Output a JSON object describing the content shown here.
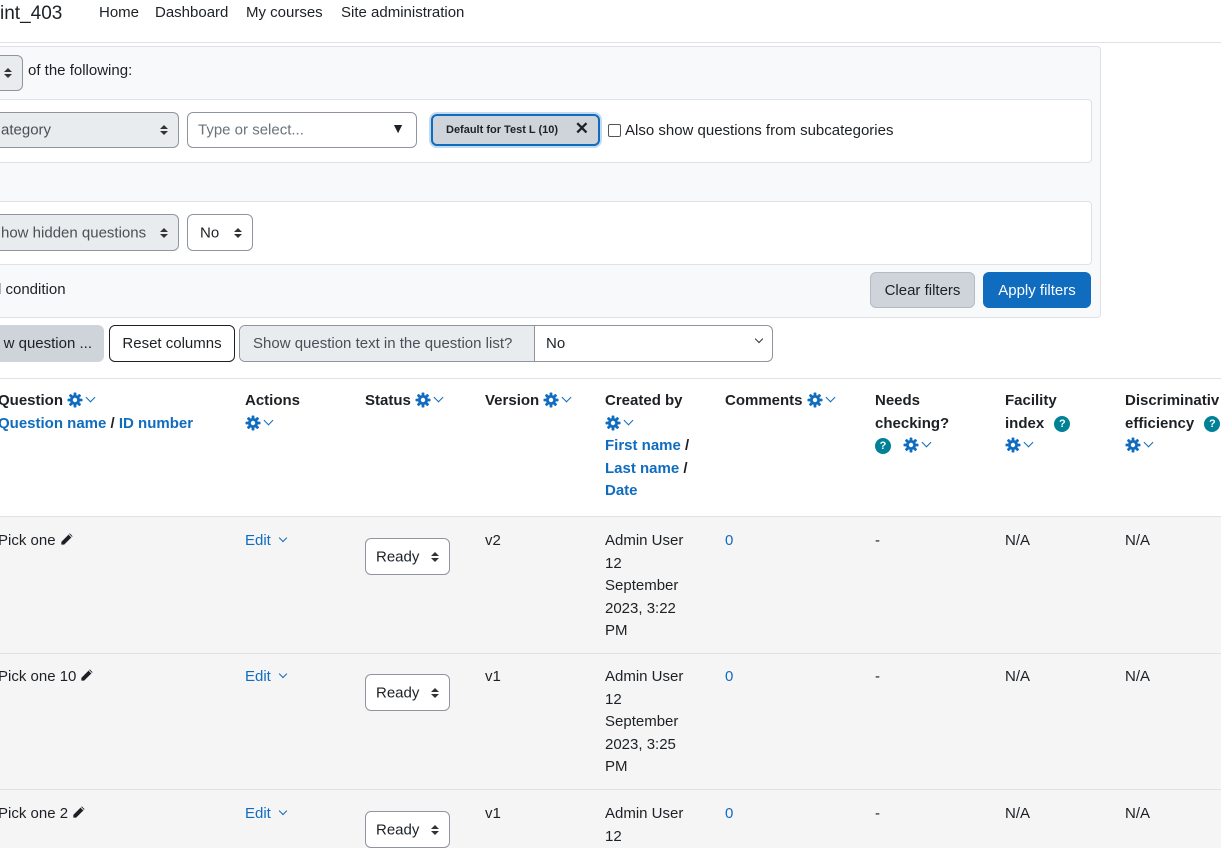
{
  "navbar": {
    "brand": "int_403",
    "links": [
      "Home",
      "Dashboard",
      "My courses",
      "Site administration"
    ]
  },
  "filters": {
    "match_suffix": "of the following:",
    "category_select": "ategory",
    "type_placeholder": "Type or select...",
    "chip_label": "Default for Test L (10)",
    "subcategories_label": "Also show questions from subcategories",
    "hidden_select": "how hidden questions",
    "hidden_value": "No",
    "add_condition": "l condition",
    "clear_filters": "Clear filters",
    "apply_filters": "Apply filters"
  },
  "toolbar": {
    "new_question": "w question ...",
    "reset_columns": "Reset columns",
    "show_text_label": "Show question text in the question list?",
    "show_text_value": "No"
  },
  "table": {
    "headers": {
      "question": "Question",
      "question_name": "Question name",
      "id_number": "ID number",
      "actions": "Actions",
      "status": "Status",
      "version": "Version",
      "created_by": "Created by",
      "first_name": "First name",
      "last_name": "Last name",
      "date": "Date",
      "comments": "Comments",
      "needs_checking_1": "Needs",
      "needs_checking_2": "checking?",
      "facility_1": "Facility",
      "facility_2": "index",
      "discrim_1": "Discriminativ",
      "discrim_2": "efficiency"
    },
    "rows": [
      {
        "question": "Pick one",
        "action": "Edit",
        "status": "Ready",
        "version": "v2",
        "created": [
          "Admin User",
          "12",
          "September",
          "2023, 3:22",
          "PM"
        ],
        "comments": "0",
        "needs": "-",
        "facility": "N/A",
        "discrim": "N/A"
      },
      {
        "question": "Pick one 10",
        "action": "Edit",
        "status": "Ready",
        "version": "v1",
        "created": [
          "Admin User",
          "12",
          "September",
          "2023, 3:25",
          "PM"
        ],
        "comments": "0",
        "needs": "-",
        "facility": "N/A",
        "discrim": "N/A"
      },
      {
        "question": "Pick one 2",
        "action": "Edit",
        "status": "Ready",
        "version": "v1",
        "created": [
          "Admin User",
          "12"
        ],
        "comments": "0",
        "needs": "-",
        "facility": "N/A",
        "discrim": "N/A"
      }
    ]
  },
  "colors": {
    "primary": "#0f6cbf",
    "help": "#008196",
    "secondary_btn": "#ced4da"
  }
}
